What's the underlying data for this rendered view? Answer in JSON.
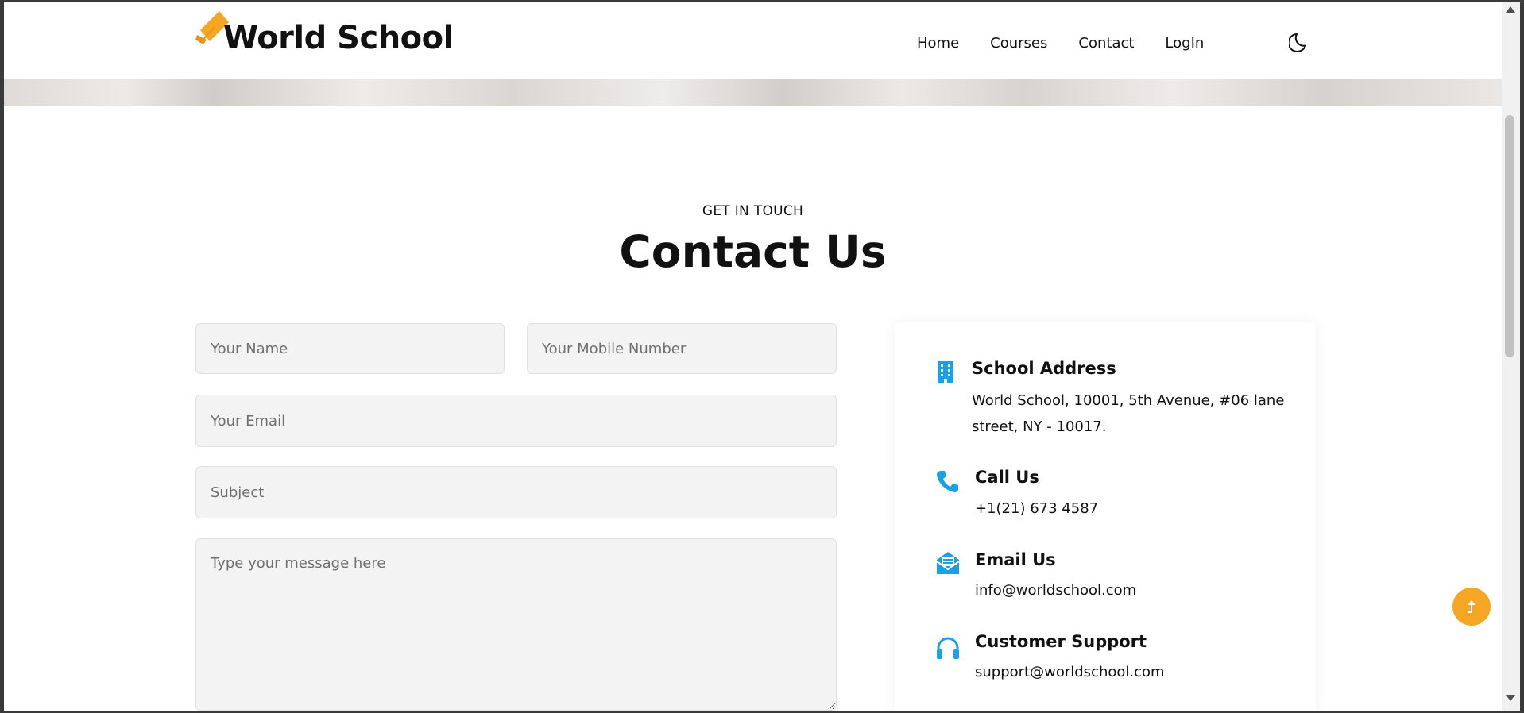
{
  "header": {
    "brand": "World School",
    "nav": [
      "Home",
      "Courses",
      "Contact",
      "LogIn"
    ]
  },
  "section": {
    "eyebrow": "GET IN TOUCH",
    "title": "Contact Us"
  },
  "form": {
    "name_placeholder": "Your Name",
    "mobile_placeholder": "Your Mobile Number",
    "email_placeholder": "Your Email",
    "subject_placeholder": "Subject",
    "message_placeholder": "Type your message here"
  },
  "info": {
    "address_title": "School Address",
    "address_line1": "World School, 10001, 5th Avenue, #06 lane",
    "address_line2": "street, NY - 10017.",
    "call_title": "Call Us",
    "call_value": "+1(21) 673 4587",
    "email_title": "Email Us",
    "email_value": "info@worldschool.com",
    "support_title": "Customer Support",
    "support_value": "support@worldschool.com"
  },
  "colors": {
    "accent": "#f5a623",
    "icon": "#1aa0e8",
    "field_bg": "#f3f3f3"
  },
  "icons": {
    "logo": "graduation-cap-icon",
    "theme": "moon-icon",
    "address": "building-icon",
    "call": "phone-icon",
    "email": "mail-open-icon",
    "support": "headphones-icon",
    "scroll_top": "arrow-up-icon"
  }
}
